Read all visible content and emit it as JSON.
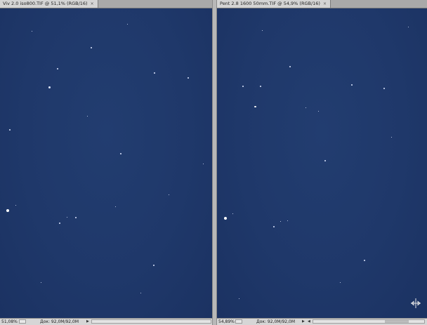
{
  "left_document": {
    "tab_title": "Viv 2.0 iso800.TIF @ 51,1% (RGB/16)",
    "tab_close": "×",
    "status": {
      "zoom": "51,08%",
      "doc_info": "Док: 92,0M/92,0M",
      "arrow": "▶"
    }
  },
  "right_document": {
    "tab_title": "Pent 2.8 1600 50mm.TIF @ 54,9% (RGB/16)",
    "tab_close": "×",
    "status": {
      "zoom": "54,89%",
      "doc_info": "Док: 92,0M/92,0M",
      "arrow": "▶",
      "scroll_left": "◀"
    }
  },
  "canvas_color": "#1f386a",
  "icons": {
    "nav": "pan-move-icon"
  }
}
